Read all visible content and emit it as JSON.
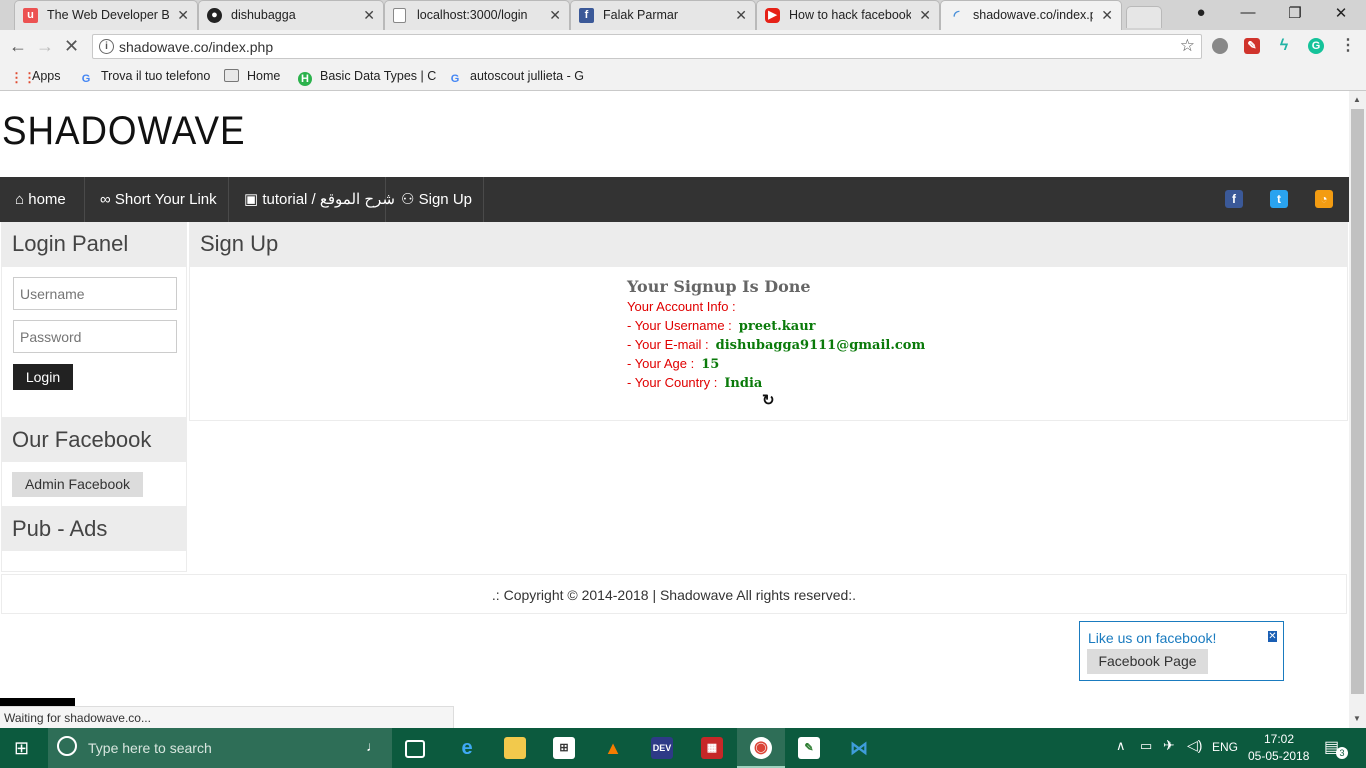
{
  "browser": {
    "tabs": [
      {
        "title": "The Web Developer Boo",
        "favicon": "udemy-icon",
        "color": "#ec5252"
      },
      {
        "title": "dishubagga",
        "favicon": "github-icon",
        "color": "#222222"
      },
      {
        "title": "localhost:3000/login",
        "favicon": "page-icon",
        "color": "#777777"
      },
      {
        "title": "Falak Parmar",
        "favicon": "facebook-icon",
        "color": "#3b5998"
      },
      {
        "title": "How to hack facebook",
        "favicon": "youtube-icon",
        "color": "#e62117"
      },
      {
        "title": "shadowave.co/index.ph",
        "favicon": "loading-icon",
        "color": "#4a90d9"
      }
    ],
    "address": "shadowave.co/index.php",
    "bookmarks": [
      {
        "label": "Apps",
        "icon": "apps-grid-icon"
      },
      {
        "label": "Trova il tuo telefono",
        "icon": "google-icon"
      },
      {
        "label": "Home",
        "icon": "page-icon"
      },
      {
        "label": "Basic Data Types | C",
        "icon": "h-icon"
      },
      {
        "label": "autoscout jullieta - G",
        "icon": "google-icon"
      }
    ],
    "status": "Waiting for shadowave.co..."
  },
  "site": {
    "logo": "SHADOWAVE",
    "nav": [
      {
        "label": "home",
        "icon": "home-icon"
      },
      {
        "label": "Short Your Link",
        "icon": "link-icon"
      },
      {
        "label": "tutorial / شرح الموقع",
        "icon": "youtube-icon"
      },
      {
        "label": "Sign Up",
        "icon": "user-plus-icon"
      }
    ],
    "login_panel": {
      "title": "Login Panel",
      "username_placeholder": "Username",
      "password_placeholder": "Password",
      "login_button": "Login"
    },
    "facebook_panel": {
      "title": "Our Facebook",
      "button": "Admin Facebook"
    },
    "ads_panel": {
      "title": "Pub - Ads"
    },
    "signup": {
      "title": "Sign Up",
      "done": "Your Signup Is Done",
      "info_label": "Your Account Info :",
      "username_label": "- Your Username :",
      "username": "preet.kaur",
      "email_label": "- Your E-mail :",
      "email": "dishubagga9111@gmail.com",
      "age_label": "- Your Age :",
      "age": "15",
      "country_label": "- Your Country :",
      "country": "India"
    },
    "footer": ".: Copyright © 2014-2018 | Shadowave All rights reserved:.",
    "fb_popup": {
      "text": "Like us on facebook!",
      "button": "Facebook Page"
    }
  },
  "taskbar": {
    "search_placeholder": "Type here to search",
    "language": "ENG",
    "time": "17:02",
    "date": "05-05-2018",
    "notifications": "3"
  }
}
